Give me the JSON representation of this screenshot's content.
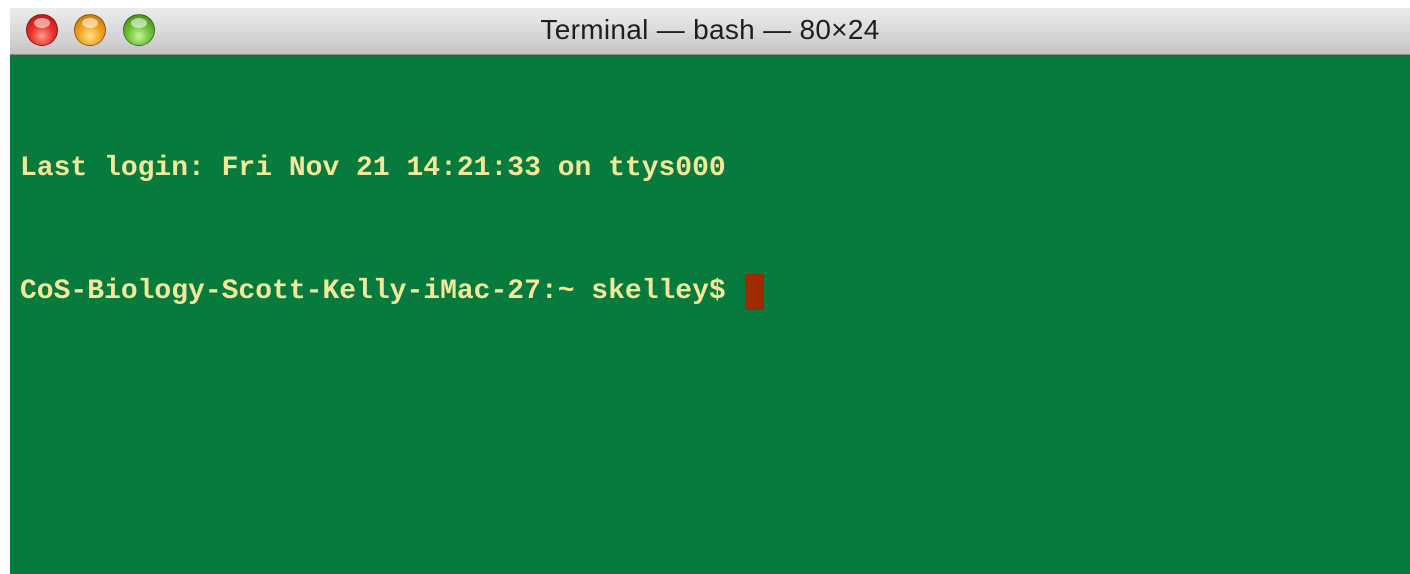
{
  "window": {
    "title": "Terminal — bash — 80×24",
    "buttons": [
      {
        "name": "close",
        "color": "#e8302a"
      },
      {
        "name": "minimize",
        "color": "#f0a020"
      },
      {
        "name": "zoom",
        "color": "#6cc232"
      }
    ]
  },
  "terminal": {
    "background": "#077a3d",
    "text_color": "#f3e89a",
    "cursor_color": "#a02a00",
    "lines": [
      "Last login: Fri Nov 21 14:21:33 on ttys000",
      "CoS-Biology-Scott-Kelly-iMac-27:~ skelley$ "
    ]
  }
}
